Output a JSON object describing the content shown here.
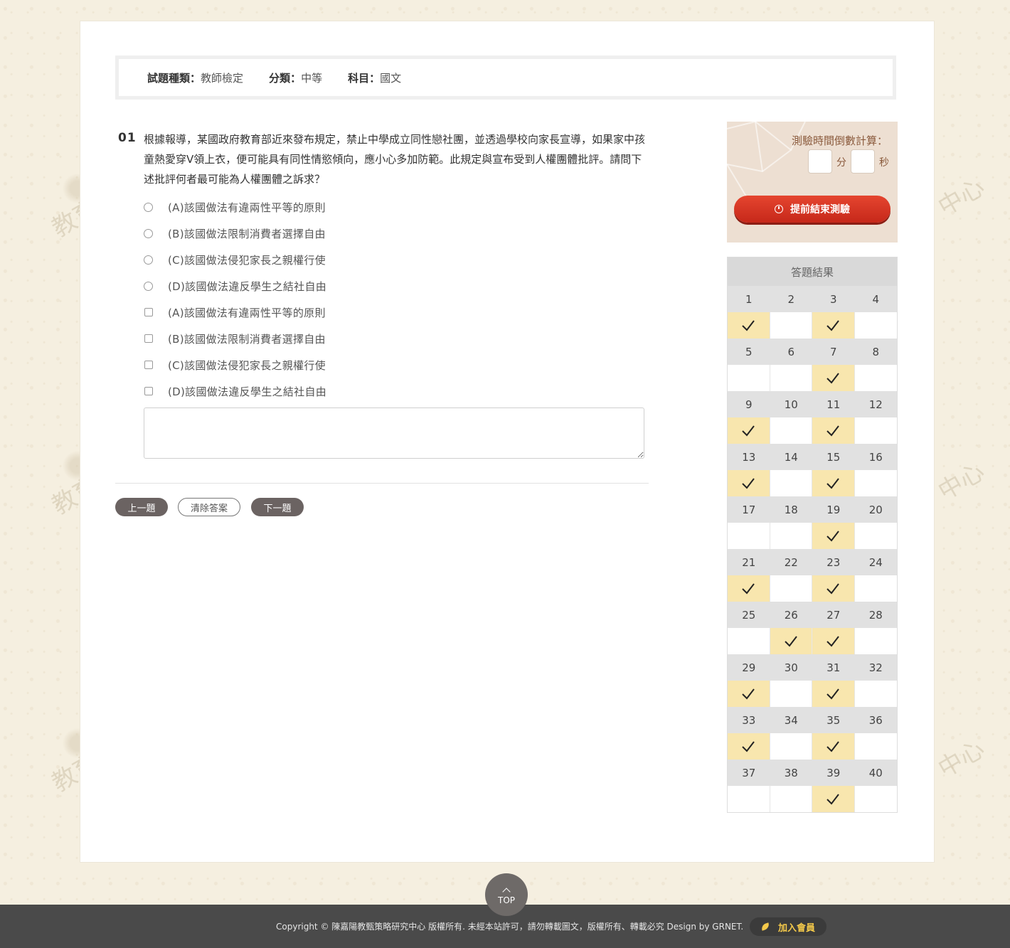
{
  "meta": {
    "type_label": "試題種類",
    "type_value": "教師檢定",
    "category_label": "分類",
    "category_value": "中等",
    "subject_label": "科目",
    "subject_value": "國文",
    "colon": "："
  },
  "question": {
    "number": "01",
    "text": "根據報導，某國政府教育部近來發布規定，禁止中學成立同性戀社團，並透過學校向家長宣導，如果家中孩童熱愛穿V領上衣，便可能具有同性情慾傾向，應小心多加防範。此規定與宣布受到人權團體批評。請問下述批評何者最可能為人權團體之訴求？",
    "radio_options": [
      "(A)該國做法有違兩性平等的原則",
      "(B)該國做法限制消費者選擇自由",
      "(C)該國做法侵犯家長之親權行使",
      "(D)該國做法違反學生之結社自由"
    ],
    "checkbox_options": [
      "(A)該國做法有違兩性平等的原則",
      "(B)該國做法限制消費者選擇自由",
      "(C)該國做法侵犯家長之親權行使",
      "(D)該國做法違反學生之結社自由"
    ]
  },
  "buttons": {
    "prev": "上一題",
    "clear": "清除答案",
    "next": "下一題"
  },
  "timer": {
    "title": "測驗時間倒數計算：",
    "minutes_unit": "分",
    "seconds_unit": "秒",
    "end_button": "提前結束測驗"
  },
  "results": {
    "title": "答題結果",
    "answered": [
      1,
      3,
      7,
      9,
      11,
      13,
      15,
      19,
      21,
      23,
      26,
      27,
      29,
      31,
      33,
      35,
      39
    ],
    "total": 40
  },
  "colors": {
    "answered_cell": "#f8e6ae",
    "end_button": "#d83a26",
    "footer": "#4a4a4a",
    "join_text": "#f4c94a"
  },
  "top_button": "TOP",
  "footer": {
    "copyright": "Copyright © 陳嘉陽教甄策略研究中心 版權所有.  未經本站許可，請勿轉載圖文，版權所有、轉載必究  Design by GRNET.",
    "join": "加入會員"
  }
}
